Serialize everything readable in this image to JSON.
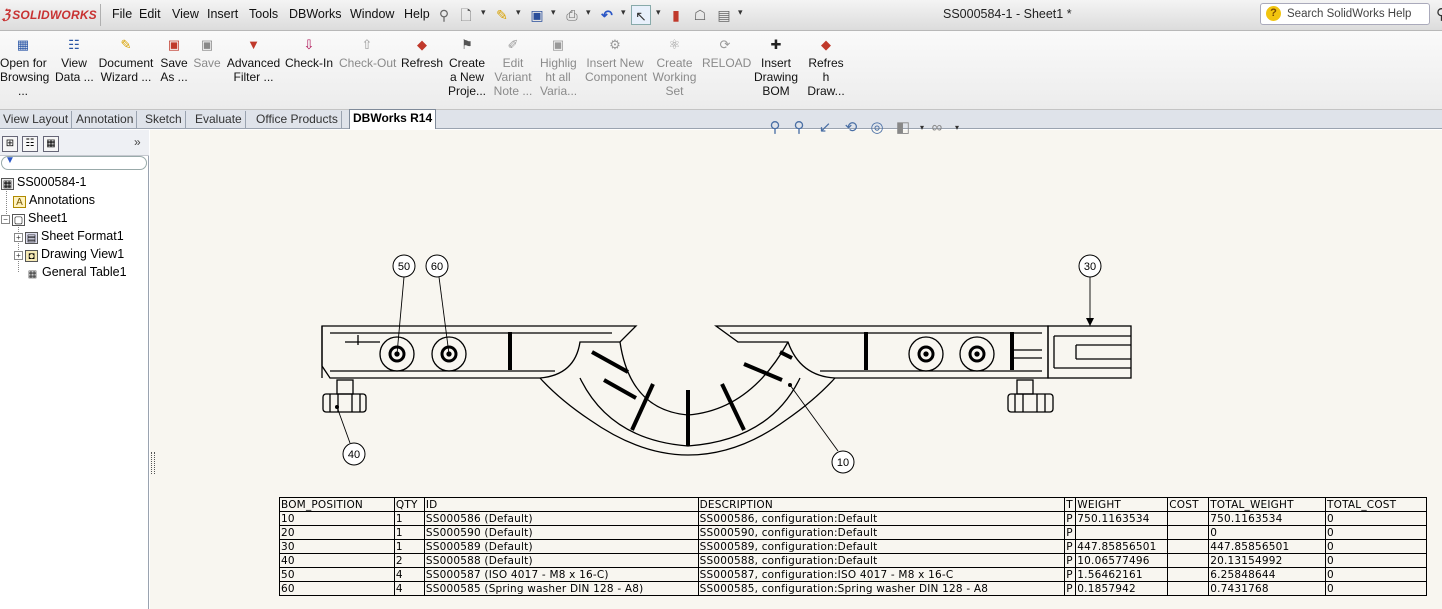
{
  "app": {
    "logo": "SOLIDWORKS",
    "document_title": "SS000584-1 - Sheet1 *",
    "help_search_placeholder": "Search SolidWorks Help"
  },
  "menu": [
    "File",
    "Edit",
    "View",
    "Insert",
    "Tools",
    "DBWorks",
    "Window",
    "Help"
  ],
  "quick_access_icons": [
    "pin-icon",
    "new-document-icon",
    "open-icon",
    "save-icon",
    "print-icon",
    "undo-icon",
    "select-icon",
    "rebuild-icon",
    "file-properties-icon",
    "options-icon"
  ],
  "ribbon": {
    "buttons": [
      {
        "label": "Open for\nBrowsing\n...",
        "icon": "open-browsing-icon",
        "enabled": true
      },
      {
        "label": "View\nData ...",
        "icon": "view-data-icon",
        "enabled": true
      },
      {
        "label": "Document\nWizard ...",
        "icon": "document-wizard-icon",
        "enabled": true
      },
      {
        "label": "Save\nAs ...",
        "icon": "save-as-icon",
        "enabled": true
      },
      {
        "label": "Save",
        "icon": "save-icon",
        "enabled": false
      },
      {
        "label": "Advanced\nFilter ...",
        "icon": "advanced-filter-icon",
        "enabled": true
      },
      {
        "label": "Check-In",
        "icon": "check-in-icon",
        "enabled": true
      },
      {
        "label": "Check-Out",
        "icon": "check-out-icon",
        "enabled": false
      },
      {
        "label": "Refresh",
        "icon": "refresh-icon",
        "enabled": true
      },
      {
        "label": "Create\na New\nProje...",
        "icon": "create-project-icon",
        "enabled": true
      },
      {
        "label": "Edit\nVariant\nNote ...",
        "icon": "edit-variant-icon",
        "enabled": false
      },
      {
        "label": "Highlig\nht all\nVaria...",
        "icon": "highlight-variants-icon",
        "enabled": false
      },
      {
        "label": "Insert New\nComponent",
        "icon": "insert-component-icon",
        "enabled": false
      },
      {
        "label": "Create\nWorking\nSet",
        "icon": "working-set-icon",
        "enabled": false
      },
      {
        "label": "RELOAD",
        "icon": "reload-icon",
        "enabled": false
      },
      {
        "label": "Insert\nDrawing\nBOM",
        "icon": "insert-bom-icon",
        "enabled": true
      },
      {
        "label": "Refres\nh\nDraw...",
        "icon": "refresh-bom-icon",
        "enabled": true
      }
    ]
  },
  "tabs": [
    {
      "label": "View Layout",
      "active": false
    },
    {
      "label": "Annotation",
      "active": false
    },
    {
      "label": "Sketch",
      "active": false
    },
    {
      "label": "Evaluate",
      "active": false
    },
    {
      "label": "Office Products",
      "active": false
    },
    {
      "label": "DBWorks R14",
      "active": true
    }
  ],
  "feature_tree": {
    "root": "SS000584-1",
    "annotations": "Annotations",
    "sheet": "Sheet1",
    "sheet_children": [
      "Sheet Format1",
      "Drawing View1",
      "General Table1"
    ]
  },
  "view_toolbar_icons": [
    "zoom-to-fit-icon",
    "zoom-to-area-icon",
    "previous-view-icon",
    "rotate-icon",
    "hide-show-icon",
    "display-style-icon",
    "view-settings-icon"
  ],
  "balloons": [
    "50",
    "60",
    "30",
    "40",
    "10"
  ],
  "bom": {
    "headers": [
      "BOM_POSITION",
      "QTY",
      "ID",
      "DESCRIPTION",
      "T",
      "WEIGHT",
      "COST",
      "TOTAL_WEIGHT",
      "TOTAL_COST"
    ],
    "rows": [
      [
        "10",
        "1",
        "SS000586 (Default)",
        "SS000586, configuration:Default",
        "P",
        "750.1163534",
        "",
        "750.1163534",
        "0"
      ],
      [
        "20",
        "1",
        "SS000590 (Default)",
        "SS000590, configuration:Default",
        "P",
        "",
        "",
        "0",
        "0"
      ],
      [
        "30",
        "1",
        "SS000589 (Default)",
        "SS000589, configuration:Default",
        "P",
        "447.85856501",
        "",
        "447.85856501",
        "0"
      ],
      [
        "40",
        "2",
        "SS000588 (Default)",
        "SS000588, configuration:Default",
        "P",
        "10.06577496",
        "",
        "20.13154992",
        "0"
      ],
      [
        "50",
        "4",
        "SS000587 (ISO 4017 - M8 x 16-C)",
        "SS000587, configuration:ISO 4017 - M8 x 16-C",
        "P",
        "1.56462161",
        "",
        "6.25848644",
        "0"
      ],
      [
        "60",
        "4",
        "SS000585 (Spring washer DIN 128 - A8)",
        "SS000585, configuration:Spring washer DIN 128 - A8",
        "P",
        "0.1857942",
        "",
        "0.7431768",
        "0"
      ]
    ]
  }
}
